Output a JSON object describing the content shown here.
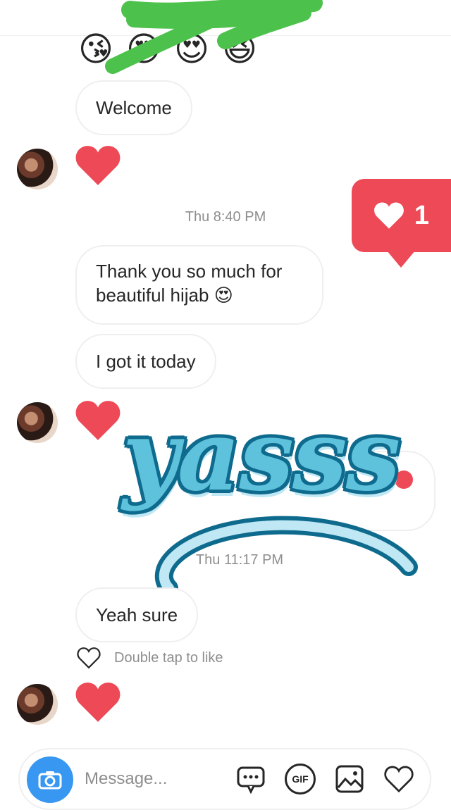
{
  "reactions_row": {
    "emojis": [
      "😘",
      "😍",
      "😍",
      "😆"
    ]
  },
  "messages": [
    {
      "text": "Welcome"
    },
    {
      "text": "Thank you so much for beautiful hijab"
    },
    {
      "text": "I got it today"
    },
    {
      "text": "Yeah sure"
    }
  ],
  "emoji_inline": "😍",
  "timestamps": [
    "Thu 8:40 PM",
    "Thu 11:17 PM"
  ],
  "notification": {
    "icon": "heart-icon",
    "count": "1",
    "color": "#ed4956"
  },
  "sticker": {
    "text": "yasss",
    "fill": "#5fc2dc",
    "outline": "#0f6b8e"
  },
  "like_hint": "Double tap to like",
  "composer": {
    "placeholder": "Message...",
    "camera_icon": "camera-icon",
    "tools": [
      "chat-bubble-icon",
      "gif-icon",
      "gallery-icon",
      "heart-icon"
    ],
    "gif_label": "GIF"
  },
  "colors": {
    "accent": "#3897f0",
    "heart": "#ed4956",
    "muted": "#8e8e8e"
  }
}
